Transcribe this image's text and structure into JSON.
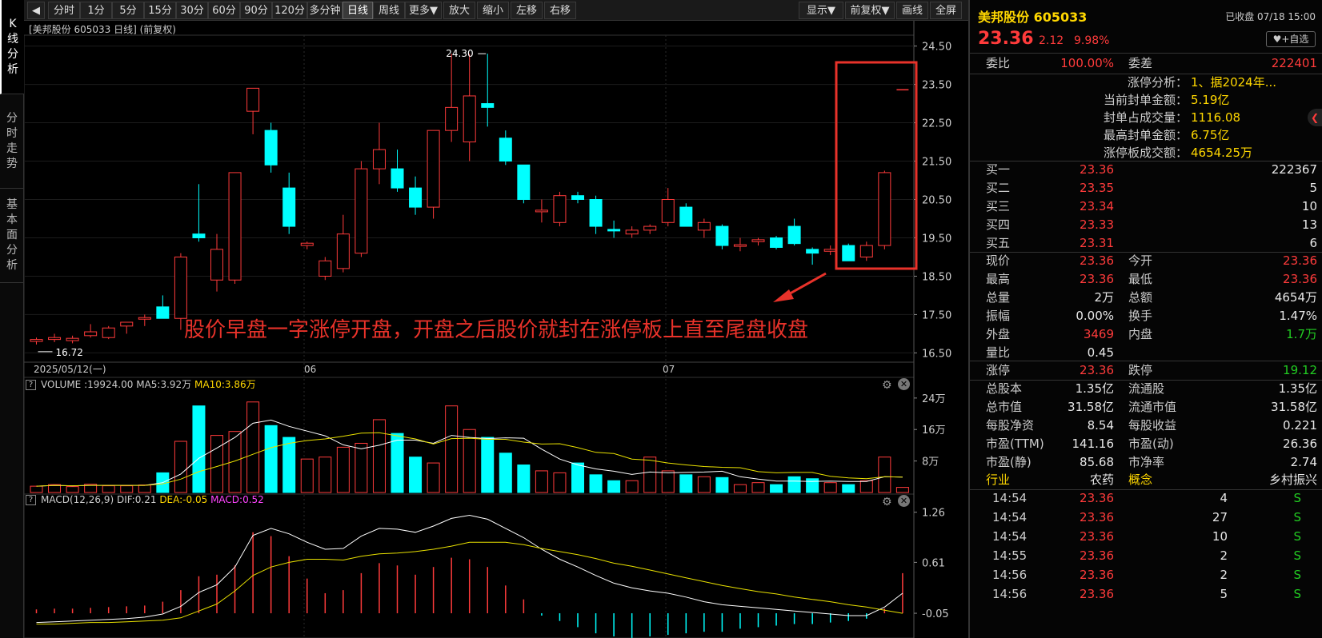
{
  "left_tabs": [
    "K线分析",
    "分时走势",
    "基本面分析"
  ],
  "toolbar": {
    "periods": [
      "分时",
      "1分",
      "5分",
      "15分",
      "30分",
      "60分",
      "90分",
      "120分",
      "多分钟",
      "日线",
      "周线",
      "更多▼"
    ],
    "active_period": "日线",
    "actions": [
      "放大",
      "缩小",
      "左移",
      "右移"
    ],
    "right_actions": [
      "显示▼",
      "前复权▼",
      "画线",
      "全屏"
    ]
  },
  "chart_title": "[美邦股份 605033 日线] (前复权)",
  "annotation": "股价早盘一字涨停开盘，开盘之后股价就封在涨停板上直至尾盘收盘",
  "highlight_color": "#e8322a",
  "colors": {
    "up": "#ff3b3b",
    "down": "#00ffff",
    "ma5": "#ffffff",
    "ma10": "#e8e000",
    "bg": "#000000"
  },
  "volume_title": {
    "label": "VOLUME",
    "value": ":19924.00",
    "ma5": "MA5:3.92万",
    "ma10": "MA10:3.86万"
  },
  "macd_title": {
    "label": "MACD(12,26,9)",
    "dif": "DIF:0.21",
    "dea": "DEA:-0.05",
    "macd": "MACD:0.52"
  },
  "chart_data": [
    {
      "type": "candlestick",
      "x_labels": [
        "2025/05/12(一)",
        "06",
        "07"
      ],
      "y_ticks": [
        "24.50",
        "23.50",
        "22.50",
        "21.50",
        "20.50",
        "19.50",
        "18.50",
        "17.50",
        "16.50"
      ],
      "ylim": [
        16.3,
        24.7
      ],
      "high_label": "24.30",
      "low_label": "16.72",
      "ohlc": [
        [
          16.8,
          16.9,
          16.72,
          16.85
        ],
        [
          16.85,
          17.0,
          16.78,
          16.9
        ],
        [
          16.82,
          16.95,
          16.75,
          16.88
        ],
        [
          16.95,
          17.25,
          16.9,
          17.05
        ],
        [
          16.9,
          17.2,
          16.86,
          17.15
        ],
        [
          17.2,
          17.3,
          17.0,
          17.3
        ],
        [
          17.4,
          17.5,
          17.2,
          17.4
        ],
        [
          17.7,
          18.0,
          17.4,
          17.4
        ],
        [
          17.4,
          19.1,
          17.1,
          19.0
        ],
        [
          19.6,
          20.9,
          19.4,
          19.5
        ],
        [
          18.4,
          19.6,
          18.1,
          19.2
        ],
        [
          18.4,
          21.2,
          18.3,
          21.2
        ],
        [
          22.8,
          23.4,
          22.2,
          23.4
        ],
        [
          22.3,
          22.5,
          21.2,
          21.4
        ],
        [
          20.8,
          21.2,
          19.6,
          19.8
        ],
        [
          19.3,
          19.4,
          19.2,
          19.36
        ],
        [
          18.5,
          19.0,
          18.4,
          18.9
        ],
        [
          18.7,
          20.1,
          18.6,
          19.6
        ],
        [
          19.1,
          21.5,
          19.0,
          21.3
        ],
        [
          21.3,
          22.5,
          20.9,
          21.8
        ],
        [
          21.3,
          21.8,
          20.7,
          20.8
        ],
        [
          20.8,
          21.1,
          20.1,
          20.3
        ],
        [
          20.3,
          22.3,
          20.0,
          22.3
        ],
        [
          22.3,
          24.3,
          22.0,
          22.9
        ],
        [
          22.0,
          24.3,
          21.5,
          23.2
        ],
        [
          23.0,
          24.3,
          22.4,
          22.9
        ],
        [
          22.1,
          22.3,
          21.4,
          21.5
        ],
        [
          21.4,
          21.4,
          20.4,
          20.5
        ],
        [
          20.2,
          20.5,
          19.9,
          20.2
        ],
        [
          19.9,
          20.7,
          19.8,
          20.6
        ],
        [
          20.6,
          20.7,
          20.4,
          20.5
        ],
        [
          20.5,
          20.6,
          19.6,
          19.8
        ],
        [
          19.7,
          19.95,
          19.5,
          19.68
        ],
        [
          19.6,
          19.8,
          19.5,
          19.7
        ],
        [
          19.7,
          19.85,
          19.6,
          19.8
        ],
        [
          19.9,
          20.8,
          19.8,
          20.5
        ],
        [
          20.3,
          20.4,
          19.8,
          19.8
        ],
        [
          19.7,
          20.0,
          19.5,
          19.9
        ],
        [
          19.8,
          19.85,
          19.2,
          19.3
        ],
        [
          19.3,
          19.5,
          19.15,
          19.3
        ],
        [
          19.4,
          19.5,
          19.3,
          19.45
        ],
        [
          19.5,
          19.55,
          19.2,
          19.25
        ],
        [
          19.8,
          20.0,
          19.3,
          19.35
        ],
        [
          19.2,
          19.25,
          18.8,
          19.1
        ],
        [
          19.15,
          19.3,
          19.05,
          19.2
        ],
        [
          19.3,
          19.35,
          18.9,
          18.9
        ],
        [
          19.0,
          19.4,
          18.9,
          19.3
        ],
        [
          19.3,
          21.25,
          19.2,
          21.2
        ],
        [
          23.36,
          23.36,
          23.36,
          23.36
        ]
      ],
      "ma5": [
        16.88,
        16.88,
        16.87,
        16.93,
        16.97,
        17.06,
        17.14,
        17.26,
        17.65,
        18.12,
        18.5,
        19.26,
        20.26,
        20.94,
        21.02,
        20.61,
        19.91,
        19.43,
        19.81,
        20.17,
        20.35,
        20.8,
        21.24,
        21.62,
        21.84,
        21.98,
        22.23,
        22.32,
        21.97,
        21.43,
        21.07,
        20.71,
        20.42,
        20.35,
        20.26,
        20.21,
        20.1,
        19.98,
        19.9,
        19.88,
        19.75,
        19.51,
        19.38,
        19.29,
        19.22,
        19.21,
        19.21,
        19.6,
        20.03
      ],
      "ma10": [
        16.88,
        16.88,
        16.87,
        16.9,
        16.92,
        16.97,
        17.02,
        17.1,
        17.29,
        17.52,
        17.69,
        18.07,
        18.7,
        19.29,
        19.82,
        20.02,
        20.08,
        20.11,
        20.22,
        20.35,
        20.48,
        20.55,
        20.58,
        20.92,
        21.22,
        21.51,
        21.77,
        21.86,
        21.84,
        21.82,
        21.9,
        21.81,
        21.61,
        21.33,
        21.13,
        21.01,
        20.91,
        20.71,
        20.63,
        20.6,
        20.47,
        20.34,
        20.19,
        20.11,
        20.08,
        20.01,
        19.91,
        19.99,
        20.09
      ]
    },
    {
      "type": "bar",
      "name": "VOLUME",
      "y_ticks": [
        "24万",
        "16万",
        "8万"
      ],
      "ylim": [
        0,
        26
      ],
      "values": [
        1.6,
        2.0,
        1.5,
        2.1,
        1.7,
        1.7,
        1.9,
        5.0,
        13.0,
        22.0,
        14.5,
        15.5,
        23.0,
        17.0,
        14.0,
        8.5,
        9.0,
        11.5,
        12.5,
        18.5,
        15.0,
        9.0,
        7.5,
        22.0,
        16.0,
        14.0,
        10.0,
        7.0,
        5.5,
        5.0,
        7.5,
        4.5,
        3.0,
        3.0,
        9.0,
        5.5,
        4.5,
        4.0,
        3.8,
        2.0,
        2.5,
        2.0,
        4.0,
        3.5,
        2.5,
        2.0,
        3.0,
        9.0,
        1.3
      ],
      "ma5": [
        1.6,
        1.8,
        1.7,
        1.8,
        1.8,
        1.8,
        1.8,
        2.5,
        4.7,
        8.7,
        11.3,
        14.0,
        17.6,
        18.4,
        16.8,
        15.6,
        14.4,
        12.1,
        11.1,
        12.0,
        13.3,
        13.3,
        12.5,
        14.5,
        14.0,
        13.7,
        13.9,
        13.8,
        11.0,
        8.5,
        7.0,
        6.0,
        5.4,
        4.6,
        5.2,
        5.0,
        5.1,
        5.2,
        5.4,
        4.0,
        3.4,
        2.9,
        2.9,
        2.8,
        2.9,
        2.8,
        2.8,
        4.0,
        3.9
      ],
      "ma10": [
        1.6,
        1.8,
        1.7,
        1.8,
        1.8,
        1.8,
        1.8,
        2.2,
        3.4,
        5.3,
        6.6,
        8.0,
        9.7,
        11.4,
        12.5,
        13.2,
        13.6,
        14.3,
        15.1,
        15.2,
        14.4,
        13.6,
        12.3,
        13.7,
        13.8,
        13.5,
        13.5,
        12.8,
        12.3,
        12.4,
        11.4,
        10.2,
        9.9,
        8.5,
        8.2,
        7.5,
        7.0,
        6.6,
        6.4,
        6.3,
        5.3,
        5.0,
        5.1,
        5.1,
        4.1,
        3.7,
        3.5,
        4.0,
        3.9
      ]
    },
    {
      "type": "bar",
      "name": "MACD",
      "y_ticks": [
        "1.26",
        "0.61",
        "-0.05"
      ],
      "ylim": [
        -0.35,
        1.35
      ],
      "hist": [
        0.05,
        0.06,
        0.06,
        0.07,
        0.08,
        0.09,
        0.1,
        0.15,
        0.3,
        0.48,
        0.5,
        0.62,
        1.05,
        1.0,
        0.74,
        0.45,
        0.26,
        0.3,
        0.52,
        0.65,
        0.62,
        0.5,
        0.6,
        0.72,
        0.7,
        0.6,
        0.36,
        0.18,
        -0.03,
        -0.1,
        -0.18,
        -0.26,
        -0.3,
        -0.32,
        -0.3,
        -0.28,
        -0.26,
        -0.24,
        -0.24,
        -0.2,
        -0.18,
        -0.16,
        -0.14,
        -0.14,
        -0.12,
        -0.1,
        -0.07,
        0.06,
        0.52
      ],
      "dif": [
        -0.17,
        -0.16,
        -0.15,
        -0.14,
        -0.13,
        -0.12,
        -0.1,
        -0.06,
        0.04,
        0.22,
        0.32,
        0.55,
        0.96,
        1.05,
        0.98,
        0.87,
        0.78,
        0.79,
        0.95,
        1.05,
        1.04,
        1.0,
        1.08,
        1.18,
        1.22,
        1.17,
        1.05,
        0.93,
        0.78,
        0.65,
        0.55,
        0.44,
        0.34,
        0.28,
        0.24,
        0.21,
        0.16,
        0.1,
        0.06,
        0.04,
        0.02,
        0.0,
        -0.02,
        -0.04,
        -0.06,
        -0.08,
        -0.08,
        0.03,
        0.21
      ],
      "dea": [
        -0.19,
        -0.19,
        -0.18,
        -0.17,
        -0.17,
        -0.16,
        -0.15,
        -0.14,
        -0.11,
        -0.02,
        0.07,
        0.24,
        0.44,
        0.55,
        0.61,
        0.65,
        0.65,
        0.64,
        0.69,
        0.72,
        0.73,
        0.75,
        0.78,
        0.82,
        0.87,
        0.87,
        0.87,
        0.84,
        0.79,
        0.75,
        0.71,
        0.66,
        0.6,
        0.56,
        0.51,
        0.46,
        0.41,
        0.36,
        0.31,
        0.27,
        0.23,
        0.2,
        0.16,
        0.13,
        0.1,
        0.06,
        0.03,
        -0.01,
        -0.05
      ]
    }
  ],
  "quote": {
    "name": "美邦股份",
    "code": "605033",
    "status": "已收盘 07/18 15:00",
    "price": "23.36",
    "change": "2.12",
    "pct": "9.98%",
    "fav": "+自选",
    "weibi_label": "委比",
    "weibi": "100.00%",
    "weicha_label": "委差",
    "weicha": "222401",
    "zt_info": [
      {
        "label": "涨停分析：",
        "value": "1、据2024年..."
      },
      {
        "label": "当前封单金额：",
        "value": "5.19亿"
      },
      {
        "label": "封单占成交量：",
        "value": "1116.08"
      },
      {
        "label": "最高封单金额：",
        "value": "6.75亿"
      },
      {
        "label": "涨停板成交额：",
        "value": "4654.25万"
      }
    ],
    "bids": [
      {
        "label": "买一",
        "price": "23.36",
        "vol": "222367"
      },
      {
        "label": "买二",
        "price": "23.35",
        "vol": "5"
      },
      {
        "label": "买三",
        "price": "23.34",
        "vol": "10"
      },
      {
        "label": "买四",
        "price": "23.33",
        "vol": "13"
      },
      {
        "label": "买五",
        "price": "23.31",
        "vol": "6"
      }
    ],
    "stats": [
      {
        "l1": "现价",
        "v1": "23.36",
        "c1": "red",
        "l2": "今开",
        "v2": "23.36",
        "c2": "red"
      },
      {
        "l1": "最高",
        "v1": "23.36",
        "c1": "red",
        "l2": "最低",
        "v2": "23.36",
        "c2": "red"
      },
      {
        "l1": "总量",
        "v1": "2万",
        "c1": "white",
        "l2": "总额",
        "v2": "4654万",
        "c2": "white"
      },
      {
        "l1": "振幅",
        "v1": "0.00%",
        "c1": "white",
        "l2": "换手",
        "v2": "1.47%",
        "c2": "white"
      },
      {
        "l1": "外盘",
        "v1": "3469",
        "c1": "red",
        "l2": "内盘",
        "v2": "1.7万",
        "c2": "green"
      },
      {
        "l1": "量比",
        "v1": "0.45",
        "c1": "white",
        "l2": "",
        "v2": "",
        "c2": "white"
      }
    ],
    "limits": {
      "l1": "涨停",
      "v1": "23.36",
      "l2": "跌停",
      "v2": "19.12"
    },
    "fundamentals": [
      {
        "l1": "总股本",
        "v1": "1.35亿",
        "l2": "流通股",
        "v2": "1.35亿"
      },
      {
        "l1": "总市值",
        "v1": "31.58亿",
        "l2": "流通市值",
        "v2": "31.58亿"
      },
      {
        "l1": "每股净资",
        "v1": "8.54",
        "l2": "每股收益",
        "v2": "0.221"
      },
      {
        "l1": "市盈(TTM)",
        "v1": "141.16",
        "l2": "市盈(动)",
        "v2": "26.36"
      },
      {
        "l1": "市盈(静)",
        "v1": "85.68",
        "l2": "市净率",
        "v2": "2.74"
      }
    ],
    "industry": {
      "l1": "行业",
      "v1": "农药",
      "l2": "概念",
      "v2": "乡村振兴"
    },
    "ticks": [
      {
        "time": "14:54",
        "price": "23.36",
        "vol": "4",
        "side": "S"
      },
      {
        "time": "14:54",
        "price": "23.36",
        "vol": "27",
        "side": "S"
      },
      {
        "time": "14:54",
        "price": "23.36",
        "vol": "10",
        "side": "S"
      },
      {
        "time": "14:55",
        "price": "23.36",
        "vol": "2",
        "side": "S"
      },
      {
        "time": "14:56",
        "price": "23.36",
        "vol": "2",
        "side": "S"
      },
      {
        "time": "14:56",
        "price": "23.36",
        "vol": "5",
        "side": "S"
      }
    ]
  }
}
